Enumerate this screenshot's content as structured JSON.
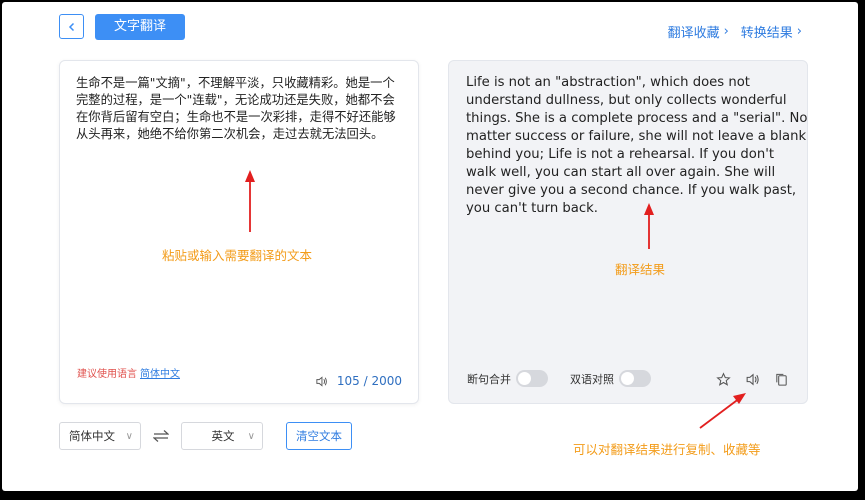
{
  "header": {
    "title": "文字翻译",
    "links": [
      {
        "label": "翻译收藏"
      },
      {
        "label": "转换结果"
      }
    ]
  },
  "source": {
    "text": "生命不是一篇\"文摘\"，不理解平淡，只收藏精彩。她是一个完整的过程，是一个\"连载\"，无论成功还是失败，她都不会在你背后留有空白；生命也不是一次彩排，走得不好还能够从头再来，她绝不给你第二次机会，走过去就无法回头。",
    "suggest_label": "建议使用语言",
    "suggest_lang": "简体中文",
    "count": "105 / 2000"
  },
  "target": {
    "text": "Life is not an \"abstraction\", which does not understand dullness, but only collects wonderful things. She is a complete process and a \"serial\". No matter success or failure, she will not leave a blank behind you; Life is not a rehearsal. If you don't walk well, you can start all over again. She will never give you a second chance. If you walk past, you can't turn back.",
    "toggle_1": "断句合并",
    "toggle_2": "双语对照"
  },
  "controls": {
    "source_lang": "简体中文",
    "target_lang": "英文",
    "clear_label": "清空文本"
  },
  "annotations": {
    "input_hint": "粘贴或输入需要翻译的文本",
    "result_hint": "翻译结果",
    "actions_hint": "可以对翻译结果进行复制、收藏等"
  },
  "colors": {
    "accent": "#3d8ff5",
    "annotation": "#f39c1a",
    "arrow": "#e21f1f"
  },
  "icons": [
    "back-icon",
    "speaker-icon",
    "star-icon",
    "copy-icon",
    "swap-icon",
    "chevron-down-icon",
    "chevron-right-icon"
  ]
}
